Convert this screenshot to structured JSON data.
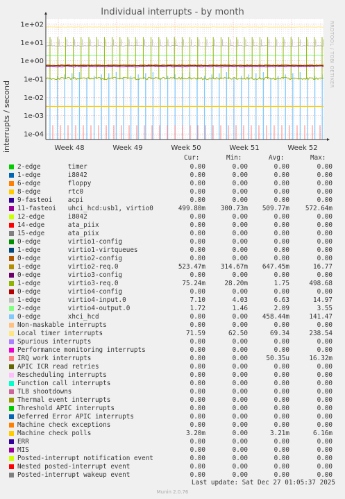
{
  "title": "Individual interrupts - by month",
  "ylabel": "interrupts / second",
  "vendor_text": "RRDTOOL / TOBI OETIKER",
  "footer": "Munin 2.0.76",
  "last_update": "Last update: Sat Dec 27 01:05:37 2025",
  "headers": {
    "cur": "Cur:",
    "min": "Min:",
    "avg": "Avg:",
    "max": "Max:"
  },
  "chart_data": {
    "type": "line",
    "title": "Individual interrupts - by month",
    "ylabel": "interrupts / second",
    "yscale": "log",
    "ylim": [
      5e-05,
      200
    ],
    "y_ticks": [
      "1e+02",
      "1e+01",
      "1e+00",
      "1e-01",
      "1e-02",
      "1e-03",
      "1e-04"
    ],
    "x_ticks": [
      "Week 48",
      "Week 49",
      "Week 50",
      "Week 51",
      "Week 52"
    ],
    "grid": true,
    "series": [
      {
        "name": "2-edge timer",
        "color": "#00cc00",
        "cur": "0.00",
        "min": "0.00",
        "avg": "0.00",
        "max": "0.00"
      },
      {
        "name": "1-edge i8042",
        "color": "#0066b3",
        "cur": "0.00",
        "min": "0.00",
        "avg": "0.00",
        "max": "0.00"
      },
      {
        "name": "6-edge floppy",
        "color": "#ff8000",
        "cur": "0.00",
        "min": "0.00",
        "avg": "0.00",
        "max": "0.00"
      },
      {
        "name": "8-edge rtc0",
        "color": "#ffcc00",
        "cur": "0.00",
        "min": "0.00",
        "avg": "0.00",
        "max": "0.00"
      },
      {
        "name": "9-fasteoi acpi",
        "color": "#330099",
        "cur": "0.00",
        "min": "0.00",
        "avg": "0.00",
        "max": "0.00"
      },
      {
        "name": "11-fasteoi uhci_hcd:usb1, virtio0",
        "color": "#990099",
        "cur": "499.80m",
        "min": "300.73m",
        "avg": "509.77m",
        "max": "572.64m"
      },
      {
        "name": "12-edge i8042",
        "color": "#ccff00",
        "cur": "0.00",
        "min": "0.00",
        "avg": "0.00",
        "max": "0.00"
      },
      {
        "name": "14-edge ata_piix",
        "color": "#ff0000",
        "cur": "0.00",
        "min": "0.00",
        "avg": "0.00",
        "max": "0.00"
      },
      {
        "name": "15-edge ata_piix",
        "color": "#808080",
        "cur": "0.00",
        "min": "0.00",
        "avg": "0.00",
        "max": "0.00"
      },
      {
        "name": "0-edge virtio1-config",
        "color": "#008f00",
        "cur": "0.00",
        "min": "0.00",
        "avg": "0.00",
        "max": "0.00"
      },
      {
        "name": "1-edge virtio1-virtqueues",
        "color": "#00487d",
        "cur": "0.00",
        "min": "0.00",
        "avg": "0.00",
        "max": "0.00"
      },
      {
        "name": "0-edge virtio2-config",
        "color": "#b35a00",
        "cur": "0.00",
        "min": "0.00",
        "avg": "0.00",
        "max": "0.00"
      },
      {
        "name": "1-edge virtio2-req.0",
        "color": "#b38f00",
        "cur": "523.47m",
        "min": "314.67m",
        "avg": "647.45m",
        "max": "16.77"
      },
      {
        "name": "0-edge virtio3-config",
        "color": "#6b006b",
        "cur": "0.00",
        "min": "0.00",
        "avg": "0.00",
        "max": "0.00"
      },
      {
        "name": "1-edge virtio3-req.0",
        "color": "#8fb300",
        "cur": "75.24m",
        "min": "28.20m",
        "avg": "1.75",
        "max": "498.68"
      },
      {
        "name": "0-edge virtio4-config",
        "color": "#b30000",
        "cur": "0.00",
        "min": "0.00",
        "avg": "0.00",
        "max": "0.00"
      },
      {
        "name": "1-edge virtio4-input.0",
        "color": "#bebebe",
        "cur": "7.10",
        "min": "4.03",
        "avg": "6.63",
        "max": "14.97"
      },
      {
        "name": "2-edge virtio4-output.0",
        "color": "#80ff80",
        "cur": "1.72",
        "min": "1.46",
        "avg": "2.09",
        "max": "3.55"
      },
      {
        "name": "0-edge xhci_hcd",
        "color": "#80c9ff",
        "cur": "0.00",
        "min": "0.00",
        "avg": "458.44m",
        "max": "141.47"
      },
      {
        "name": "Non-maskable interrupts",
        "color": "#ffc080",
        "cur": "0.00",
        "min": "0.00",
        "avg": "0.00",
        "max": "0.00"
      },
      {
        "name": "Local timer interrupts",
        "color": "#ffe680",
        "cur": "71.59",
        "min": "62.50",
        "avg": "69.34",
        "max": "238.54"
      },
      {
        "name": "Spurious interrupts",
        "color": "#aa80ff",
        "cur": "0.00",
        "min": "0.00",
        "avg": "0.00",
        "max": "0.00"
      },
      {
        "name": "Performance monitoring interrupts",
        "color": "#ee00cc",
        "cur": "0.00",
        "min": "0.00",
        "avg": "0.00",
        "max": "0.00"
      },
      {
        "name": "IRQ work interrupts",
        "color": "#ff8080",
        "cur": "0.00",
        "min": "0.00",
        "avg": "50.35u",
        "max": "16.32m"
      },
      {
        "name": "APIC ICR read retries",
        "color": "#666600",
        "cur": "0.00",
        "min": "0.00",
        "avg": "0.00",
        "max": "0.00"
      },
      {
        "name": "Rescheduling interrupts",
        "color": "#ffbfff",
        "cur": "0.00",
        "min": "0.00",
        "avg": "0.00",
        "max": "0.00"
      },
      {
        "name": "Function call interrupts",
        "color": "#00ffcc",
        "cur": "0.00",
        "min": "0.00",
        "avg": "0.00",
        "max": "0.00"
      },
      {
        "name": "TLB shootdowns",
        "color": "#cc6699",
        "cur": "0.00",
        "min": "0.00",
        "avg": "0.00",
        "max": "0.00"
      },
      {
        "name": "Thermal event interrupts",
        "color": "#999900",
        "cur": "0.00",
        "min": "0.00",
        "avg": "0.00",
        "max": "0.00"
      },
      {
        "name": "Threshold APIC interrupts",
        "color": "#00cc00",
        "cur": "0.00",
        "min": "0.00",
        "avg": "0.00",
        "max": "0.00"
      },
      {
        "name": "Deferred Error APIC interrupts",
        "color": "#0066b3",
        "cur": "0.00",
        "min": "0.00",
        "avg": "0.00",
        "max": "0.00"
      },
      {
        "name": "Machine check exceptions",
        "color": "#ff8000",
        "cur": "0.00",
        "min": "0.00",
        "avg": "0.00",
        "max": "0.00"
      },
      {
        "name": "Machine check polls",
        "color": "#ffcc00",
        "cur": "3.20m",
        "min": "0.00",
        "avg": "3.21m",
        "max": "6.16m"
      },
      {
        "name": "ERR",
        "color": "#330099",
        "cur": "0.00",
        "min": "0.00",
        "avg": "0.00",
        "max": "0.00"
      },
      {
        "name": "MIS",
        "color": "#990099",
        "cur": "0.00",
        "min": "0.00",
        "avg": "0.00",
        "max": "0.00"
      },
      {
        "name": "Posted-interrupt notification event",
        "color": "#ccff00",
        "cur": "0.00",
        "min": "0.00",
        "avg": "0.00",
        "max": "0.00"
      },
      {
        "name": "Nested posted-interrupt event",
        "color": "#ff0000",
        "cur": "0.00",
        "min": "0.00",
        "avg": "0.00",
        "max": "0.00"
      },
      {
        "name": "Posted-interrupt wakeup event",
        "color": "#808080",
        "cur": "0.00",
        "min": "0.00",
        "avg": "0.00",
        "max": "0.00"
      }
    ]
  }
}
